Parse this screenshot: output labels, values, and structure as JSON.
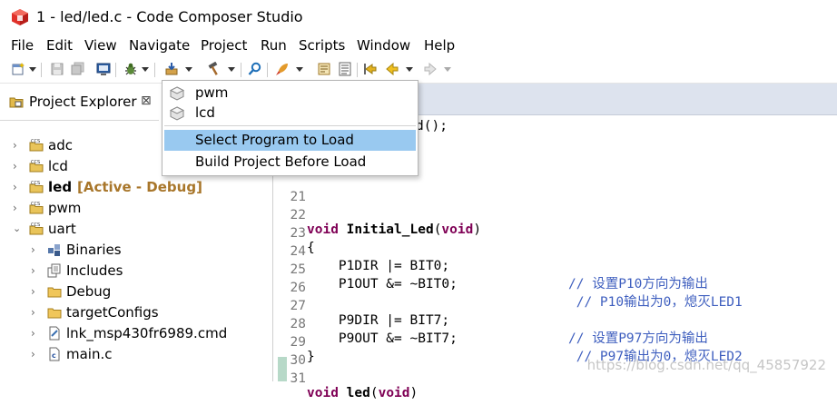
{
  "window": {
    "title": "1 - led/led.c - Code Composer Studio",
    "app_icon": "ccs-cube-icon"
  },
  "menubar": [
    "File",
    "Edit",
    "View",
    "Navigate",
    "Project",
    "Run",
    "Scripts",
    "Window",
    "Help"
  ],
  "project_explorer": {
    "tab_title": "Project Explorer",
    "close_glyph": "⊠",
    "items": [
      {
        "name": "adc",
        "expanded": false
      },
      {
        "name": "lcd",
        "expanded": false
      },
      {
        "name": "led",
        "active_tag": "[Active - Debug]",
        "expanded": false
      },
      {
        "name": "pwm",
        "expanded": false
      },
      {
        "name": "uart",
        "expanded": true
      }
    ],
    "uart_children": [
      {
        "name": "Binaries",
        "icon": "binaries-icon"
      },
      {
        "name": "Includes",
        "icon": "includes-icon"
      },
      {
        "name": "Debug",
        "icon": "folder-icon"
      },
      {
        "name": "targetConfigs",
        "icon": "folder-icon"
      },
      {
        "name": "lnk_msp430fr6989.cmd",
        "icon": "cmd-file-icon"
      },
      {
        "name": "main.c",
        "icon": "c-file-icon"
      }
    ]
  },
  "load_dropdown": {
    "programs": [
      "pwm",
      "lcd"
    ],
    "actions": [
      "Select Program to Load",
      "Build Project Before Load"
    ]
  },
  "editor": {
    "top_fragment": "d();",
    "lines": [
      {
        "num": "21",
        "text": ""
      },
      {
        "num": "22",
        "text": "void Initial_Led(void)"
      },
      {
        "num": "23",
        "text": "{"
      },
      {
        "num": "24",
        "code": "    P1DIR |= BIT0;",
        "comment": "// 设置P10方向为输出"
      },
      {
        "num": "25",
        "code": "    P1OUT &= ~BIT0;",
        "comment": " // P10输出为0，熄灭LED1"
      },
      {
        "num": "26",
        "text": ""
      },
      {
        "num": "27",
        "code": "    P9DIR |= BIT7;",
        "comment": "// 设置P97方向为输出"
      },
      {
        "num": "28",
        "code": "    P9OUT &= ~BIT7;",
        "comment": " // P97输出为0，熄灭LED2"
      },
      {
        "num": "29",
        "text": "}"
      },
      {
        "num": "30",
        "text": ""
      },
      {
        "num": "31",
        "text": "void led(void)"
      }
    ]
  },
  "watermark": "https://blog.csdn.net/qq_45857922"
}
